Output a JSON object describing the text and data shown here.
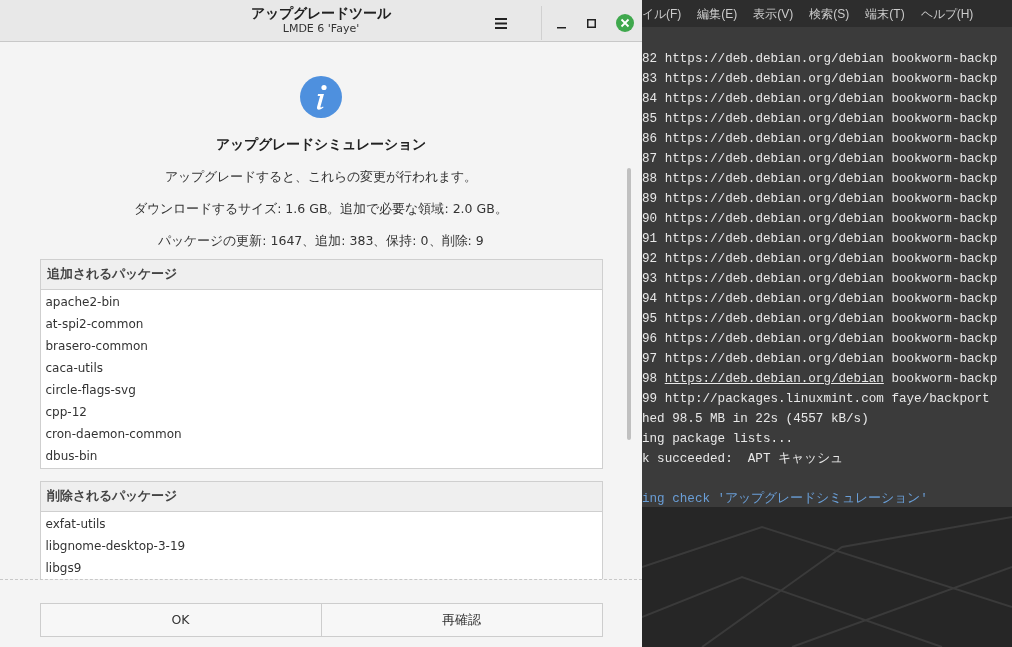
{
  "dialog": {
    "title": "アップグレードツール",
    "subtitle": "LMDE 6 'Faye'",
    "heading": "アップグレードシミュレーション",
    "lines": [
      "アップグレードすると、これらの変更が行われます。",
      "ダウンロードするサイズ: 1.6 GB。追加で必要な領域: 2.0 GB。",
      "パッケージの更新: 1647、追加: 383、保持: 0、削除: 9"
    ],
    "lists": [
      {
        "header": "追加されるパッケージ",
        "items": [
          "apache2-bin",
          "at-spi2-common",
          "brasero-common",
          "caca-utils",
          "circle-flags-svg",
          "cpp-12",
          "cron-daemon-common",
          "dbus-bin"
        ]
      },
      {
        "header": "削除されるパッケージ",
        "items": [
          "exfat-utils",
          "libgnome-desktop-3-19",
          "libgs9"
        ]
      }
    ],
    "buttons": [
      "OK",
      "再確認"
    ]
  },
  "terminal": {
    "menu": [
      "イル(F)",
      "編集(E)",
      "表示(V)",
      "検索(S)",
      "端末(T)",
      "ヘルプ(H)"
    ],
    "lines": [
      {
        "kind": "repo",
        "number": "82",
        "url": "https://deb.debian.org/debian",
        "rest": "bookworm-backp",
        "hovered": false
      },
      {
        "kind": "repo",
        "number": "83",
        "url": "https://deb.debian.org/debian",
        "rest": "bookworm-backp",
        "hovered": false
      },
      {
        "kind": "repo",
        "number": "84",
        "url": "https://deb.debian.org/debian",
        "rest": "bookworm-backp",
        "hovered": false
      },
      {
        "kind": "repo",
        "number": "85",
        "url": "https://deb.debian.org/debian",
        "rest": "bookworm-backp",
        "hovered": false
      },
      {
        "kind": "repo",
        "number": "86",
        "url": "https://deb.debian.org/debian",
        "rest": "bookworm-backp",
        "hovered": false
      },
      {
        "kind": "repo",
        "number": "87",
        "url": "https://deb.debian.org/debian",
        "rest": "bookworm-backp",
        "hovered": false
      },
      {
        "kind": "repo",
        "number": "88",
        "url": "https://deb.debian.org/debian",
        "rest": "bookworm-backp",
        "hovered": false
      },
      {
        "kind": "repo",
        "number": "89",
        "url": "https://deb.debian.org/debian",
        "rest": "bookworm-backp",
        "hovered": false
      },
      {
        "kind": "repo",
        "number": "90",
        "url": "https://deb.debian.org/debian",
        "rest": "bookworm-backp",
        "hovered": false
      },
      {
        "kind": "repo",
        "number": "91",
        "url": "https://deb.debian.org/debian",
        "rest": "bookworm-backp",
        "hovered": false
      },
      {
        "kind": "repo",
        "number": "92",
        "url": "https://deb.debian.org/debian",
        "rest": "bookworm-backp",
        "hovered": false
      },
      {
        "kind": "repo",
        "number": "93",
        "url": "https://deb.debian.org/debian",
        "rest": "bookworm-backp",
        "hovered": false
      },
      {
        "kind": "repo",
        "number": "94",
        "url": "https://deb.debian.org/debian",
        "rest": "bookworm-backp",
        "hovered": false
      },
      {
        "kind": "repo",
        "number": "95",
        "url": "https://deb.debian.org/debian",
        "rest": "bookworm-backp",
        "hovered": false
      },
      {
        "kind": "repo",
        "number": "96",
        "url": "https://deb.debian.org/debian",
        "rest": "bookworm-backp",
        "hovered": false
      },
      {
        "kind": "repo",
        "number": "97",
        "url": "https://deb.debian.org/debian",
        "rest": "bookworm-backp",
        "hovered": false
      },
      {
        "kind": "repo",
        "number": "98",
        "url": "https://deb.debian.org/debian",
        "rest": "bookworm-backp",
        "hovered": true
      },
      {
        "kind": "repo",
        "number": "99",
        "url": "http://packages.linuxmint.com",
        "rest": "faye/backport",
        "hovered": false
      },
      {
        "kind": "plain",
        "text": "hed 98.5 MB in 22s (4557 kB/s)"
      },
      {
        "kind": "plain",
        "text": "ing package lists..."
      },
      {
        "kind": "plain",
        "text": "k succeeded:  APT キャッシュ"
      },
      {
        "kind": "blank"
      },
      {
        "kind": "info",
        "text": "ing check 'アップグレードシミュレーション'"
      }
    ]
  }
}
